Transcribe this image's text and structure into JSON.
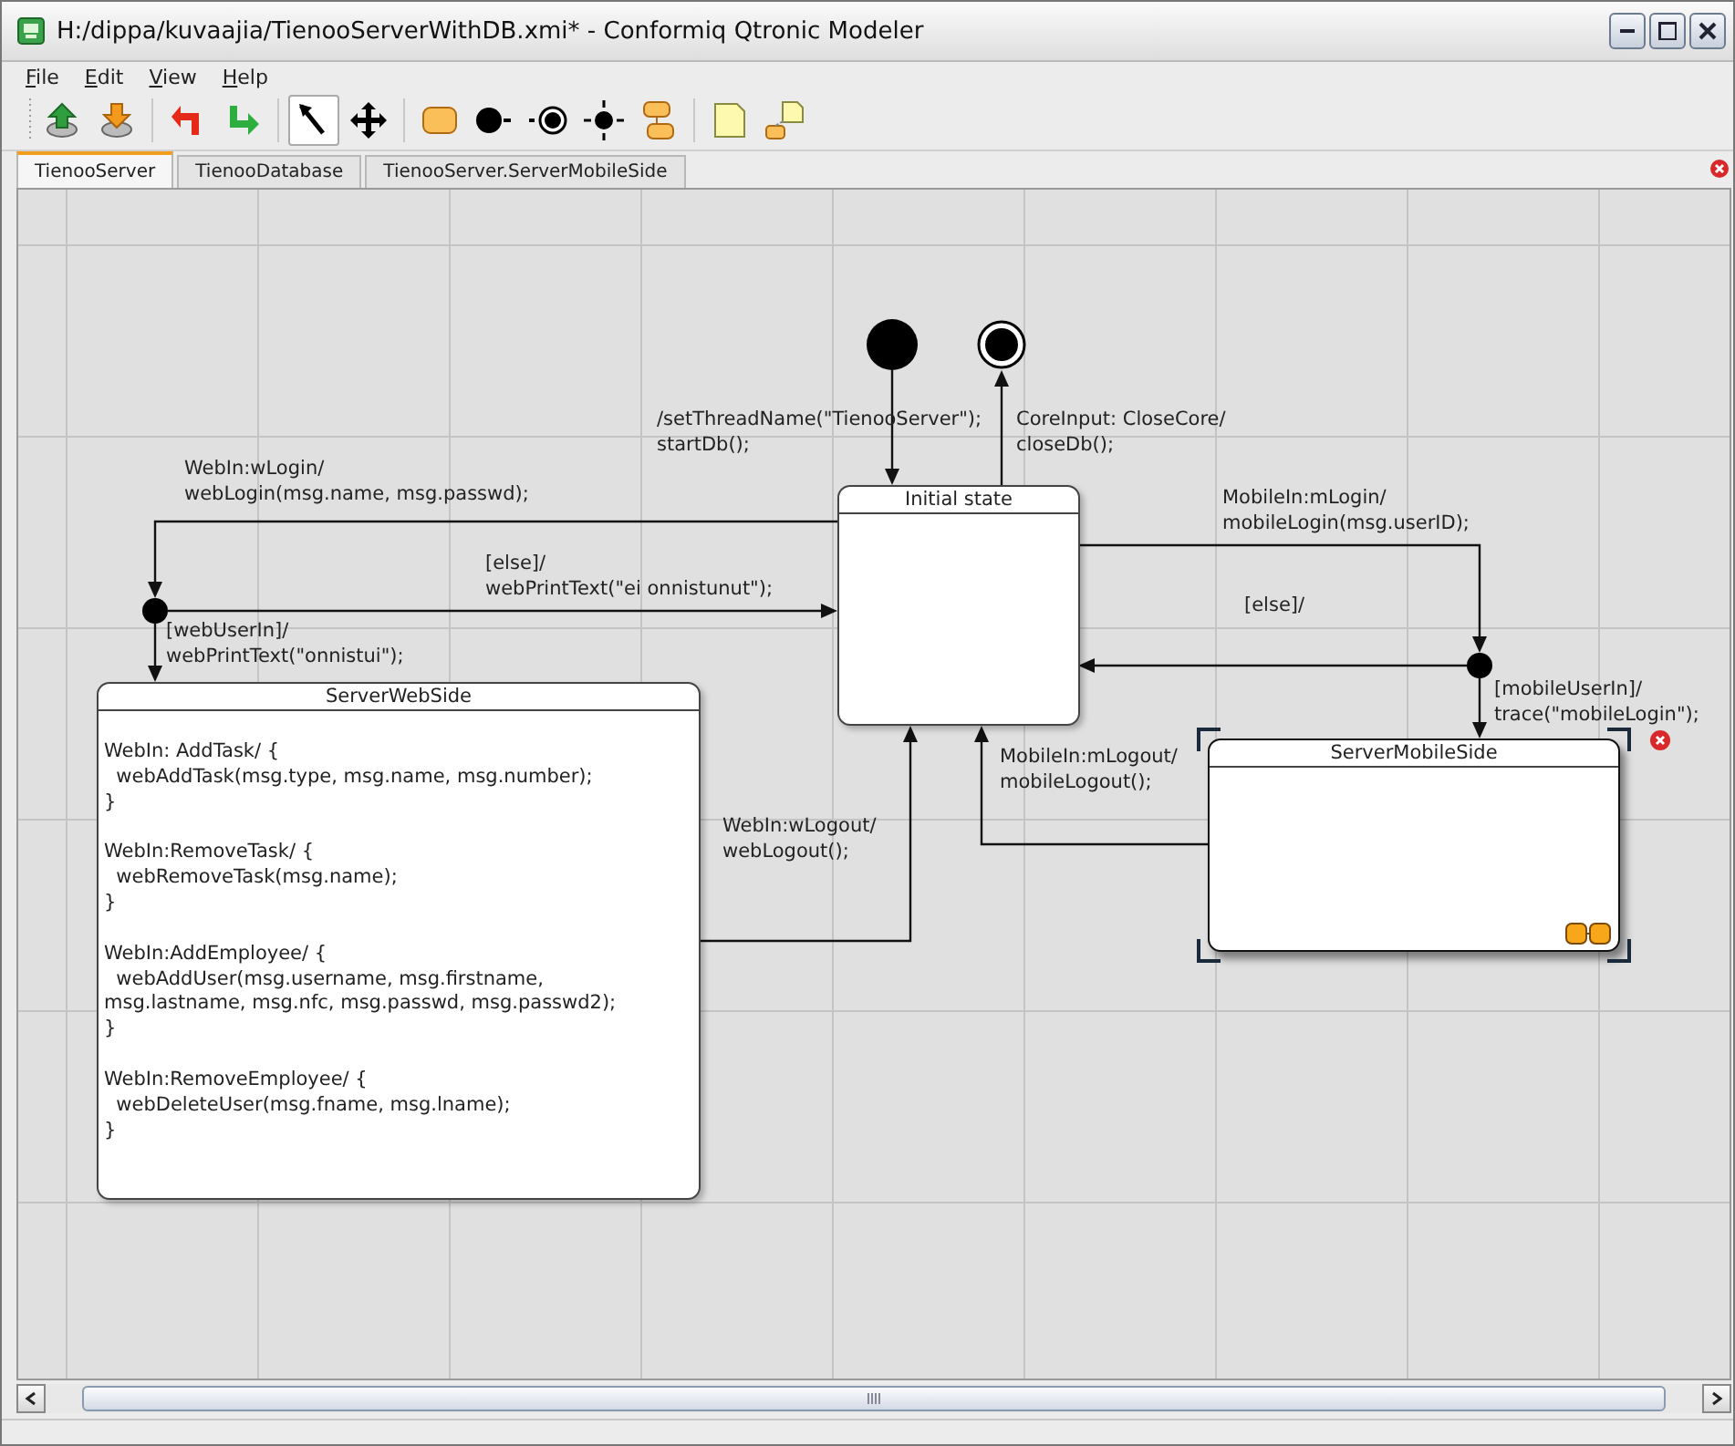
{
  "window": {
    "title": "H:/dippa/kuvaajia/TienooServerWithDB.xmi* - Conformiq Qtronic Modeler"
  },
  "menu": [
    "File",
    "Edit",
    "View",
    "Help"
  ],
  "toolbar": [
    {
      "kind": "open",
      "selected": false
    },
    {
      "kind": "save",
      "selected": false
    },
    {
      "kind": "undo",
      "selected": false
    },
    {
      "kind": "redo",
      "selected": false
    },
    {
      "kind": "pointer",
      "selected": true
    },
    {
      "kind": "move",
      "selected": false
    },
    {
      "kind": "state",
      "selected": false
    },
    {
      "kind": "initial",
      "selected": false
    },
    {
      "kind": "final",
      "selected": false
    },
    {
      "kind": "choice",
      "selected": false
    },
    {
      "kind": "composite",
      "selected": false
    },
    {
      "kind": "note",
      "selected": false
    },
    {
      "kind": "notelink",
      "selected": false
    }
  ],
  "tabs": [
    {
      "label": "TienooServer",
      "selected": true
    },
    {
      "label": "TienooDatabase",
      "selected": false
    },
    {
      "label": "TienooServer.ServerMobileSide",
      "selected": false
    }
  ],
  "diagram": {
    "states": [
      {
        "kind": "simple",
        "name": "Initial state",
        "selected": false
      },
      {
        "kind": "composite",
        "name": "ServerWebSide",
        "selected": false,
        "body": [
          "WebIn: AddTask/ {\n  webAddTask(msg.type, msg.name, msg.number);\n}",
          "WebIn:RemoveTask/ {\n  webRemoveTask(msg.name);\n}",
          "WebIn:AddEmployee/ {\n  webAddUser(msg.username, msg.firstname,\nmsg.lastname, msg.nfc, msg.passwd, msg.passwd2);\n}",
          "WebIn:RemoveEmployee/ {\n  webDeleteUser(msg.fname, msg.lname);\n}"
        ]
      },
      {
        "kind": "submachine",
        "name": "ServerMobileSide",
        "selected": true
      }
    ],
    "transitions": [
      {
        "label": "/setThreadName(\"TienooServer\");\nstartDb();"
      },
      {
        "label": "CoreInput: CloseCore/\ncloseDb();"
      },
      {
        "label": "WebIn:wLogin/\nwebLogin(msg.name, msg.passwd);"
      },
      {
        "label": "[else]/\nwebPrintText(\"ei onnistunut\");"
      },
      {
        "label": "MobileIn:mLogin/\nmobileLogin(msg.userID);"
      },
      {
        "label": "[webUserIn]/\nwebPrintText(\"onnistui\");"
      },
      {
        "label": "[else]/"
      },
      {
        "label": "[mobileUserIn]/\ntrace(\"mobileLogin\");"
      },
      {
        "label": "MobileIn:mLogout/\nmobileLogout();"
      },
      {
        "label": "WebIn:wLogout/\nwebLogout();"
      }
    ]
  }
}
